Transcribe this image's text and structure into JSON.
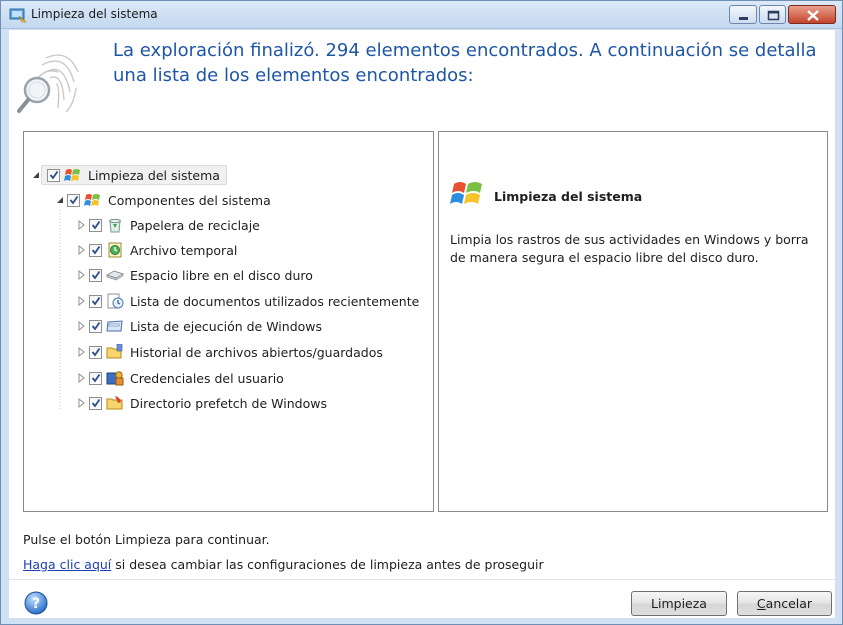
{
  "window": {
    "title": "Limpieza del sistema"
  },
  "header": {
    "message": "La exploración finalizó. 294 elementos encontrados. A continuación se detalla una lista de los elementos encontrados:"
  },
  "tree": {
    "root": {
      "label": "Limpieza del sistema",
      "checked": true
    },
    "group": {
      "label": "Componentes del sistema",
      "checked": true
    },
    "items": [
      {
        "label": "Papelera de reciclaje",
        "icon": "recycle-bin-icon",
        "checked": true
      },
      {
        "label": "Archivo temporal",
        "icon": "temp-file-icon",
        "checked": true
      },
      {
        "label": "Espacio libre en el disco duro",
        "icon": "hard-disk-icon",
        "checked": true
      },
      {
        "label": "Lista de documentos utilizados recientemente",
        "icon": "recent-documents-icon",
        "checked": true
      },
      {
        "label": "Lista de ejecución de Windows",
        "icon": "run-list-icon",
        "checked": true
      },
      {
        "label": "Historial de archivos abiertos/guardados",
        "icon": "folder-history-icon",
        "checked": true
      },
      {
        "label": "Credenciales del usuario",
        "icon": "credentials-icon",
        "checked": true
      },
      {
        "label": "Directorio prefetch de Windows",
        "icon": "prefetch-folder-icon",
        "checked": true
      }
    ]
  },
  "detail": {
    "title": "Limpieza del sistema",
    "description": "Limpia los rastros de sus actividades en Windows y borra de manera segura el espacio libre del disco duro."
  },
  "footer": {
    "hint": "Pulse el botón Limpieza para continuar.",
    "link_text": "Haga clic aquí",
    "link_suffix": " si desea cambiar las configuraciones de limpieza antes de proseguir",
    "clean_label": "Limpieza",
    "cancel_first": "C",
    "cancel_rest": "ancelar"
  },
  "colors": {
    "header_text": "#1e56a6",
    "link": "#1a3fb5"
  }
}
